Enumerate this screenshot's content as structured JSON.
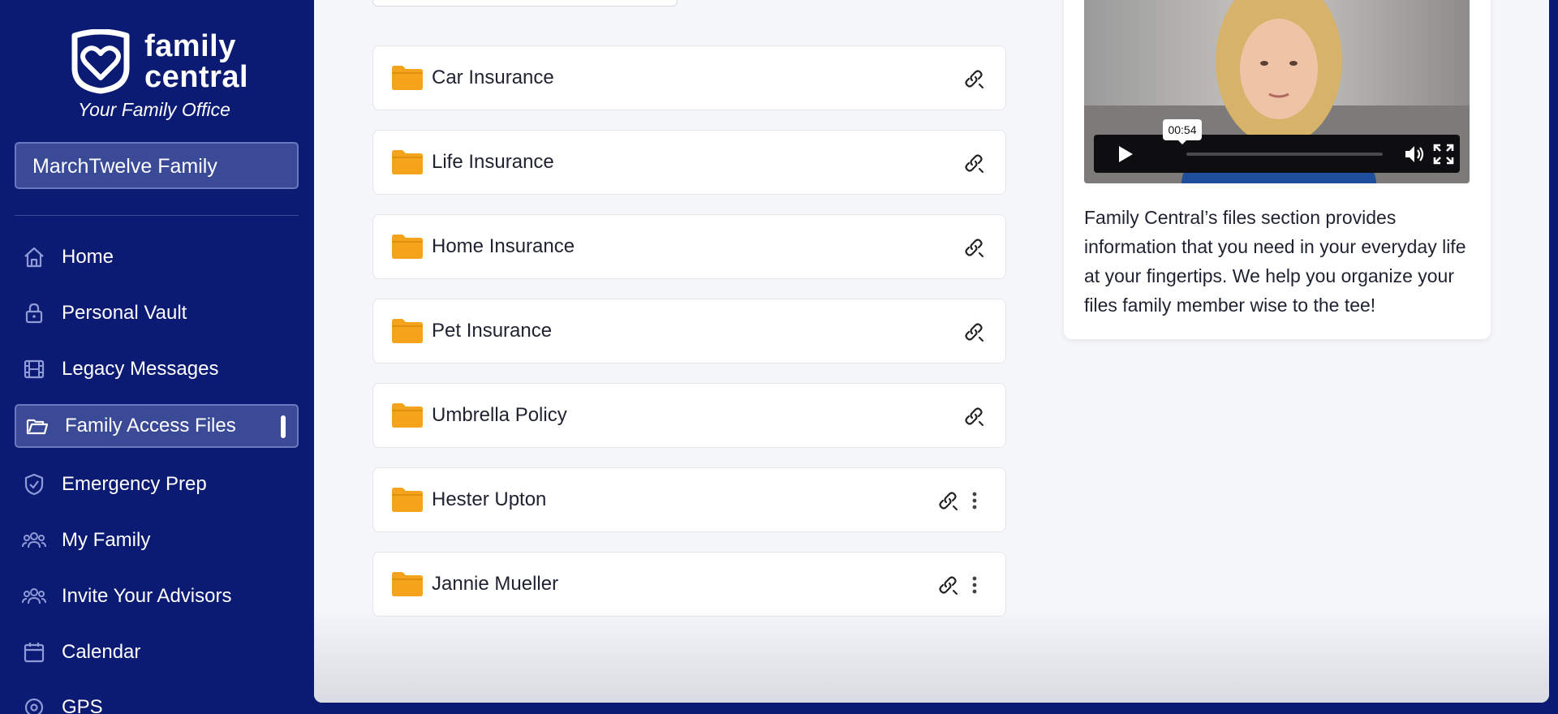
{
  "sidebar": {
    "brand_line1": "family",
    "brand_line2": "central",
    "tagline": "Your Family Office",
    "family_selector": "MarchTwelve Family",
    "nav": [
      {
        "label": "Home",
        "icon": "home-icon"
      },
      {
        "label": "Personal Vault",
        "icon": "lock-icon"
      },
      {
        "label": "Legacy Messages",
        "icon": "film-icon"
      },
      {
        "label": "Family Access Files",
        "icon": "folder-open-icon",
        "active": true
      },
      {
        "label": "Emergency Prep",
        "icon": "shield-check-icon"
      },
      {
        "label": "My Family",
        "icon": "people-icon"
      },
      {
        "label": "Invite Your Advisors",
        "icon": "people-icon"
      },
      {
        "label": "Calendar",
        "icon": "calendar-icon"
      },
      {
        "label": "GPS",
        "icon": "location-icon"
      }
    ]
  },
  "folders": [
    {
      "name": "Car Insurance",
      "has_menu": false
    },
    {
      "name": "Life Insurance",
      "has_menu": false
    },
    {
      "name": "Home Insurance",
      "has_menu": false
    },
    {
      "name": "Pet Insurance",
      "has_menu": false
    },
    {
      "name": "Umbrella Policy",
      "has_menu": false
    },
    {
      "name": "Hester Upton",
      "has_menu": true
    },
    {
      "name": "Jannie Mueller",
      "has_menu": true
    }
  ],
  "video": {
    "time_tooltip": "00:54",
    "description": "Family Central’s files section provides information that you need in your everyday life at your fingertips. We help you organize your files family member wise to the tee!"
  },
  "colors": {
    "sidebar_bg": "#0b1a73",
    "active_bg": "#3a4a97",
    "folder": "#f5a31a",
    "main_bg": "#f6f7fb"
  }
}
